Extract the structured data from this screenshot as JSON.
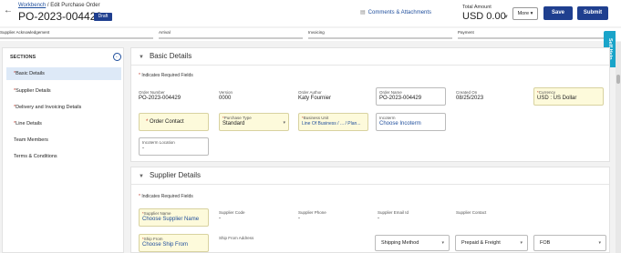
{
  "header": {
    "back_icon": "arrow-left-icon",
    "breadcrumb_link": "Workbench",
    "breadcrumb_rest": " / Edit Purchase Order",
    "title": "PO-2023-004429",
    "badge": "Draft",
    "comments_label": "Comments & Attachments",
    "total_label": "Total Amount",
    "total_value": "USD 0.00",
    "more_label": "More",
    "save_label": "Save",
    "submit_label": "Submit"
  },
  "progress": {
    "steps": [
      "Supplier Acknowledgement",
      "Arrival",
      "Invoicing",
      "Payment"
    ]
  },
  "self_help": "Self Help",
  "sidebar": {
    "title": "SECTIONS",
    "items": [
      {
        "label": "Basic Details",
        "required": true
      },
      {
        "label": "Supplier Details",
        "required": true
      },
      {
        "label": "Delivery and Invoicing Details",
        "required": true
      },
      {
        "label": "Line Details",
        "required": true
      },
      {
        "label": "Team Members",
        "required": false
      },
      {
        "label": "Terms & Conditions",
        "required": false
      }
    ]
  },
  "basic": {
    "title": "Basic Details",
    "req_note": "Indicates Required Fields",
    "order_number_label": "Order Number",
    "order_number": "PO-2023-004429",
    "version_label": "Version",
    "version": "0000",
    "author_label": "Order Author",
    "author": "Katy Fournier",
    "order_name_label": "Order Name",
    "order_name": "PO-2023-004429",
    "created_label": "Created On",
    "created": "08/25/2023",
    "currency_label": "Currency",
    "currency": "USD : US Dollar",
    "order_contact_label": "Order Contact",
    "purchase_type_label": "Purchase Type",
    "purchase_type": "Standard",
    "business_unit_label": "Business Unit",
    "business_unit": "Line Of Business / ... / Plan...",
    "incoterm_label": "Incoterm",
    "incoterm": "Choose Incoterm",
    "incoterm_location_label": "Incoterm Location",
    "incoterm_location": "-"
  },
  "supplier": {
    "title": "Supplier Details",
    "req_note": "Indicates Required Fields",
    "name_label": "Supplier Name",
    "name": "Choose Supplier Name",
    "code_label": "Supplier Code",
    "code": "-",
    "phone_label": "Supplier Phone",
    "phone": "-",
    "email_label": "Supplier Email Id",
    "email": "-",
    "contact_label": "Supplier Contact",
    "ship_from_label": "Ship From",
    "ship_from": "Choose Ship From",
    "ship_from_address_label": "Ship From Address",
    "shipping_method": "Shipping Method",
    "freight": "Prepaid & Freight",
    "fob": "FOB"
  }
}
